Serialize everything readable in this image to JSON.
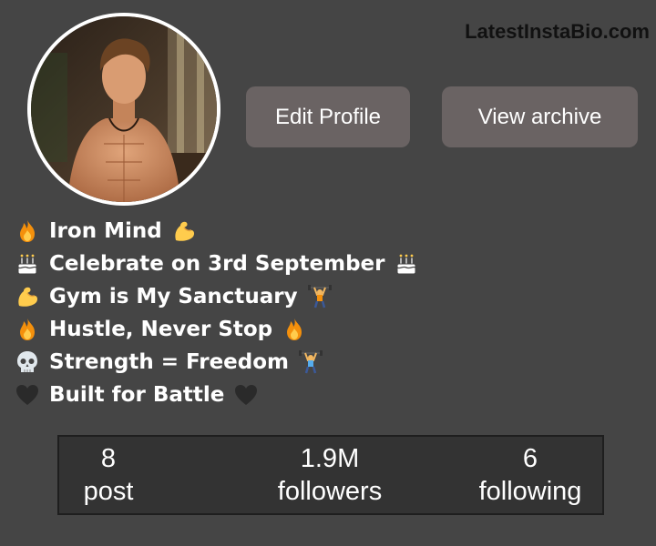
{
  "watermark": "LatestInstaBio.com",
  "avatar": {
    "icon": "profile-photo"
  },
  "buttons": {
    "edit_profile": "Edit Profile",
    "view_archive": "View archive"
  },
  "bio": [
    {
      "text": "Iron Mind",
      "lead_icon": "fire-icon",
      "trail_icon": "flexed-biceps-icon"
    },
    {
      "text": "Celebrate on 3rd September",
      "lead_icon": "birthday-cake-icon",
      "trail_icon": "birthday-cake-icon"
    },
    {
      "text": "Gym is My Sanctuary",
      "lead_icon": "flexed-biceps-icon",
      "trail_icon": "weight-lifter-icon"
    },
    {
      "text": "Hustle, Never Stop",
      "lead_icon": "fire-icon",
      "trail_icon": "fire-icon"
    },
    {
      "text": "Strength = Freedom",
      "lead_icon": "skull-icon",
      "trail_icon": "weight-lifter-icon"
    },
    {
      "text": "Built for Battle",
      "lead_icon": "black-heart-icon",
      "trail_icon": "black-heart-icon"
    }
  ],
  "stats": {
    "posts": {
      "value": "8",
      "label": "post"
    },
    "followers": {
      "value": "1.9M",
      "label": "followers"
    },
    "following": {
      "value": "6",
      "label": "following"
    }
  },
  "colors": {
    "background": "#454545",
    "button": "#6a6363",
    "stats_panel": "#333333",
    "text": "#ffffff",
    "watermark": "#111111"
  }
}
